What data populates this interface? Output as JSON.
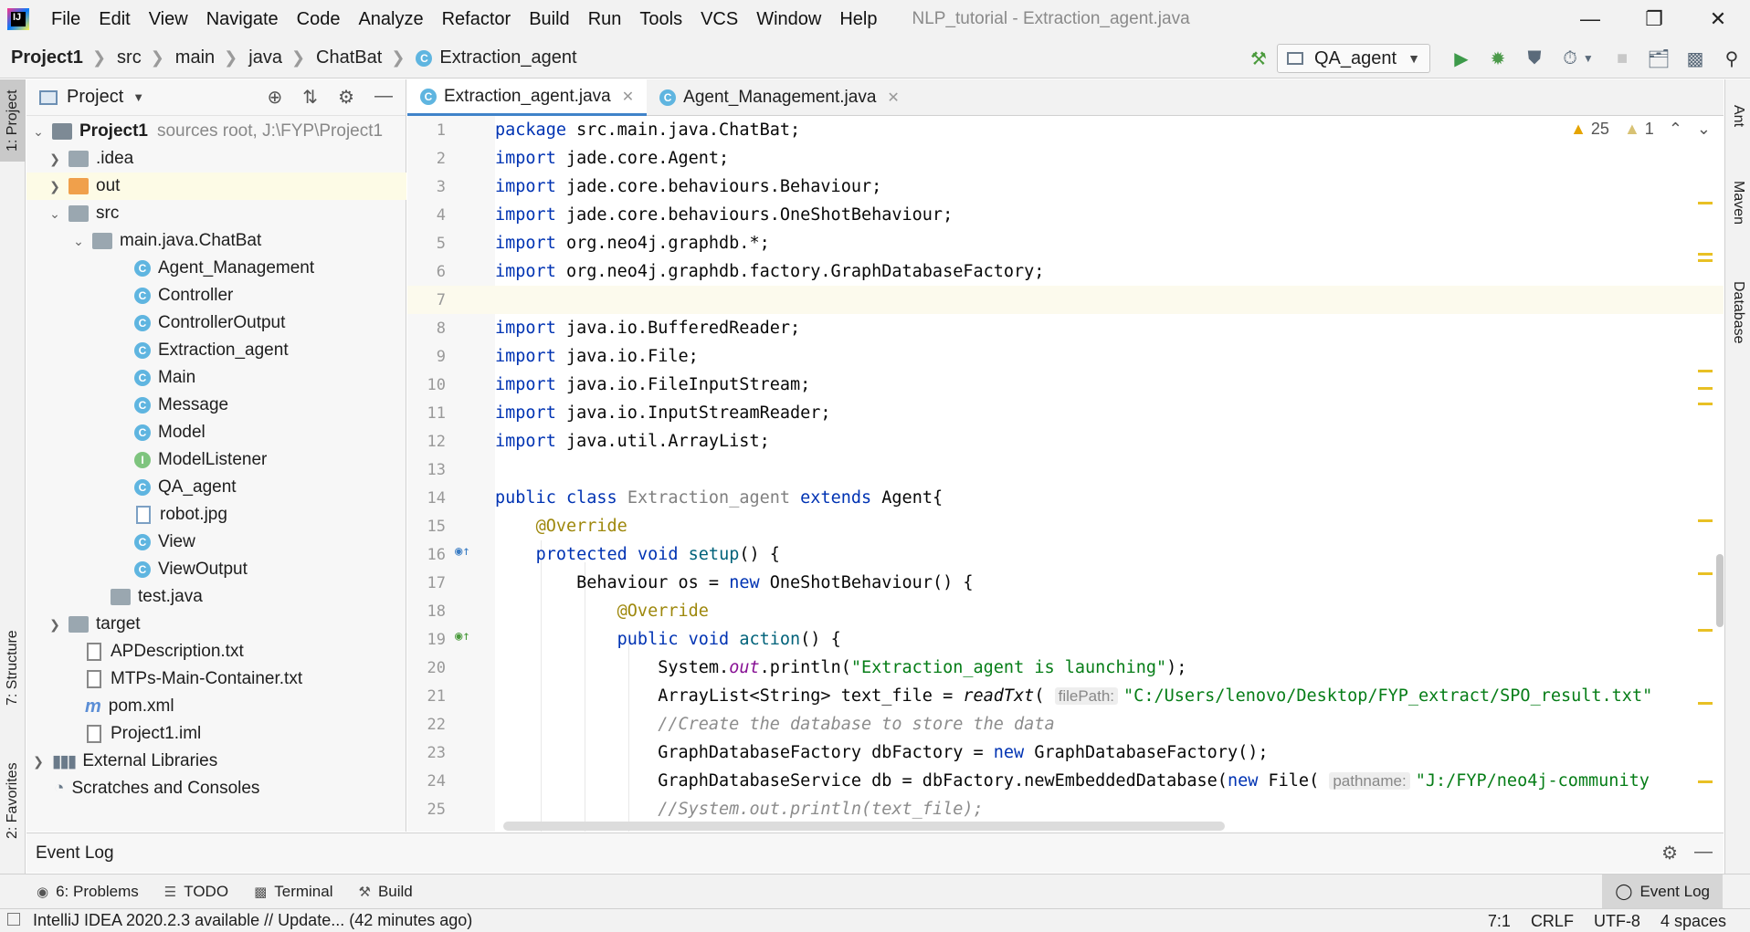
{
  "menubar": {
    "items": [
      {
        "label": "File"
      },
      {
        "label": "Edit"
      },
      {
        "label": "View"
      },
      {
        "label": "Navigate"
      },
      {
        "label": "Code"
      },
      {
        "label": "Analyze"
      },
      {
        "label": "Refactor"
      },
      {
        "label": "Build"
      },
      {
        "label": "Run"
      },
      {
        "label": "Tools"
      },
      {
        "label": "VCS"
      },
      {
        "label": "Window"
      },
      {
        "label": "Help"
      }
    ],
    "window_title": "NLP_tutorial - Extraction_agent.java"
  },
  "breadcrumb": {
    "items": [
      "Project1",
      "src",
      "main",
      "java",
      "ChatBat",
      "Extraction_agent"
    ]
  },
  "toolbar": {
    "run_config": "QA_agent"
  },
  "left_stripe": {
    "project": "1: Project",
    "structure": "7: Structure",
    "favorites": "2: Favorites"
  },
  "right_stripe": {
    "ant": "Ant",
    "maven": "Maven",
    "database": "Database"
  },
  "project_panel": {
    "title": "Project",
    "tree": [
      {
        "label": "Project1",
        "extra": "sources root,  J:\\FYP\\Project1"
      },
      {
        "label": ".idea"
      },
      {
        "label": "out"
      },
      {
        "label": "src"
      },
      {
        "label": "main.java.ChatBat"
      },
      {
        "label": "Agent_Management"
      },
      {
        "label": "Controller"
      },
      {
        "label": "ControllerOutput"
      },
      {
        "label": "Extraction_agent"
      },
      {
        "label": "Main"
      },
      {
        "label": "Message"
      },
      {
        "label": "Model"
      },
      {
        "label": "ModelListener"
      },
      {
        "label": "QA_agent"
      },
      {
        "label": "robot.jpg"
      },
      {
        "label": "View"
      },
      {
        "label": "ViewOutput"
      },
      {
        "label": "test.java"
      },
      {
        "label": "target"
      },
      {
        "label": "APDescription.txt"
      },
      {
        "label": "MTPs-Main-Container.txt"
      },
      {
        "label": "pom.xml"
      },
      {
        "label": "Project1.iml"
      },
      {
        "label": "External Libraries"
      },
      {
        "label": "Scratches and Consoles"
      }
    ]
  },
  "editor": {
    "tabs": [
      {
        "label": "Extraction_agent.java"
      },
      {
        "label": "Agent_Management.java"
      }
    ],
    "warnings_count": "25",
    "weak_warnings_count": "1",
    "code": {
      "l1_kw": "package",
      "l1": " src.main.java.ChatBat;",
      "import": "import",
      "l2": " jade.core.Agent;",
      "l3": " jade.core.behaviours.Behaviour;",
      "l4": " jade.core.behaviours.OneShotBehaviour;",
      "l5": " org.neo4j.graphdb.*;",
      "l6": " org.neo4j.graphdb.factory.GraphDatabaseFactory;",
      "l8": " java.io.BufferedReader;",
      "l9": " java.io.File;",
      "l10": " java.io.FileInputStream;",
      "l11": " java.io.InputStreamReader;",
      "l12": " java.util.ArrayList;",
      "l14_public": "public",
      "l14_class": "class",
      "l14_name": "Extraction_agent",
      "l14_extends": "extends",
      "l14_rest": " Agent{",
      "override": "@Override",
      "l16_protected": "protected",
      "l16_void": "void",
      "l16_fn": "setup",
      "l16_rest": "() {",
      "l17_a": "Behaviour os = ",
      "l17_new": "new",
      "l17_b": " OneShotBehaviour() {",
      "l19_public": "public",
      "l19_void": "void",
      "l19_fn": "action",
      "l19_rest": "() {",
      "l20_a": "System.",
      "l20_out": "out",
      "l20_b": ".println(",
      "l20_str": "\"Extraction_agent is launching\"",
      "l20_c": ");",
      "l21_a": "ArrayList<String> text_file = ",
      "l21_fn": "readTxt",
      "l21_b": "(",
      "l21_hint": "filePath:",
      "l21_str": "\"C:/Users/lenovo/Desktop/FYP_extract/SPO_result.txt\"",
      "l22_cmt": "//Create the database to store the data",
      "l23_a": "GraphDatabaseFactory dbFactory = ",
      "l23_new": "new",
      "l23_b": " GraphDatabaseFactory();",
      "l24_a": "GraphDatabaseService db = dbFactory.newEmbeddedDatabase(",
      "l24_new": "new",
      "l24_b": " File(",
      "l24_hint": "pathname:",
      "l24_str": "\"J:/FYP/neo4j-community",
      "l25_cmt": "//System.out.println(text_file);"
    }
  },
  "bottom": {
    "event_log_title": "Event Log",
    "tool_buttons": [
      {
        "label": "6: Problems"
      },
      {
        "label": "TODO"
      },
      {
        "label": "Terminal"
      },
      {
        "label": "Build"
      }
    ],
    "event_log_button": "Event Log"
  },
  "statusbar": {
    "message": "IntelliJ IDEA 2020.2.3 available // Update... (42 minutes ago)",
    "position": "7:1",
    "line_sep": "CRLF",
    "encoding": "UTF-8",
    "indent": "4 spaces"
  }
}
